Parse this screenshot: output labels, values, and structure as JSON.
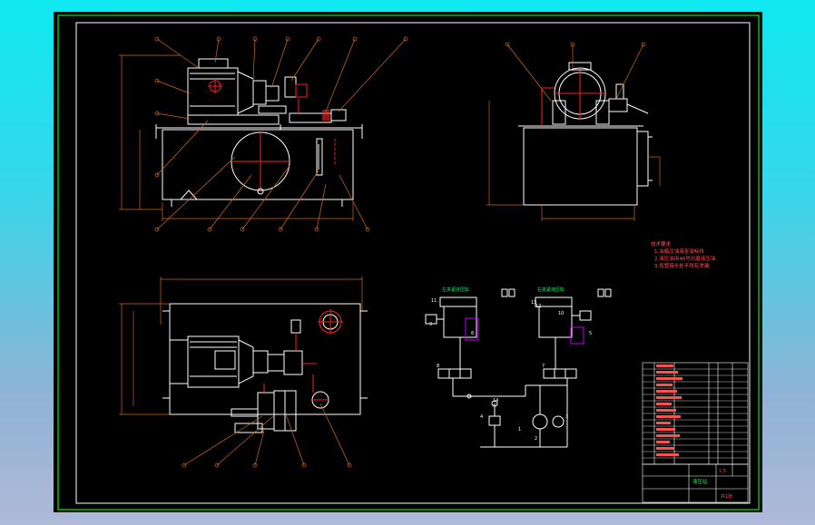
{
  "colors": {
    "frame_outer": "#00c000",
    "frame_inner": "#ffffff",
    "line_white": "#ffffff",
    "leader": "#d2691e",
    "red_center": "#ff2020",
    "note_text": "#ff5050",
    "title_green": "#00ff66",
    "magenta": "#c000ff"
  },
  "notes": {
    "title": "技术要求",
    "lines": [
      "1.油箱注油液至油标线",
      "2.液压油用46号抗磨液压油",
      "3.各管接头处不得有渗漏"
    ]
  },
  "schematic": {
    "cylinder_left_label": "左夹紧液压缸",
    "cylinder_right_label": "右夹紧液压缸",
    "tags": [
      "11",
      "13",
      "12",
      "10",
      "9",
      "14",
      "8",
      "7",
      "1",
      "2",
      "3",
      "4",
      "5",
      "6"
    ]
  },
  "title_block": {
    "drawing_name": "液压站",
    "scale": "1:5",
    "sheet": "共1张"
  },
  "icons": [
    "valve-symbol-icon",
    "pump-symbol-icon",
    "motor-symbol-icon",
    "filter-symbol-icon"
  ]
}
